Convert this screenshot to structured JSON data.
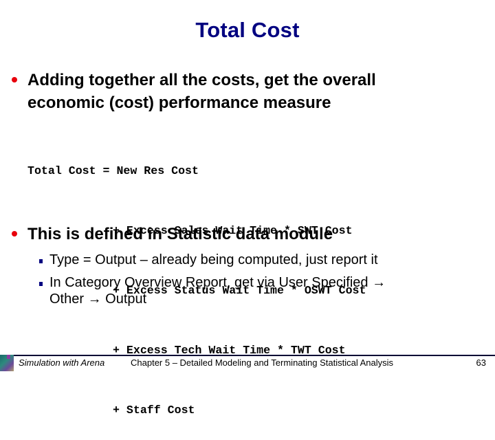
{
  "slide": {
    "title": "Total Cost",
    "bullets": [
      {
        "text_line1": "Adding together all the costs, get the overall",
        "text_line2": "economic (cost) performance measure"
      },
      {
        "text": "This is defined in Statistic data module",
        "sub_bullets": [
          {
            "text": "Type = Output – already being computed, just report it"
          },
          {
            "text_line1": "In Category Overview Report, get via User Specified →",
            "text_line2": "Other → Output"
          }
        ]
      }
    ],
    "formula": {
      "lines": [
        "Total Cost = New Res Cost",
        "+ Excess Sales Wait Time * SWT Cost",
        "+ Excess Status Wait Time * OSWT Cost",
        "+ Excess Tech Wait Time * TWT Cost",
        "+ Staff Cost"
      ]
    }
  },
  "footer": {
    "book_title": "Simulation with Arena",
    "chapter": "Chapter 5 – Detailed Modeling and Terminating Statistical Analysis",
    "page_number": "63"
  },
  "colors": {
    "title": "#000080",
    "main_bullet": "#e8000c",
    "sub_bullet": "#000080",
    "footer_rule": "#000033"
  },
  "icons": {
    "main_bullet": "red-dot-bullet-icon",
    "sub_bullet": "blue-square-bullet-icon",
    "logo": "publisher-logo-icon"
  }
}
